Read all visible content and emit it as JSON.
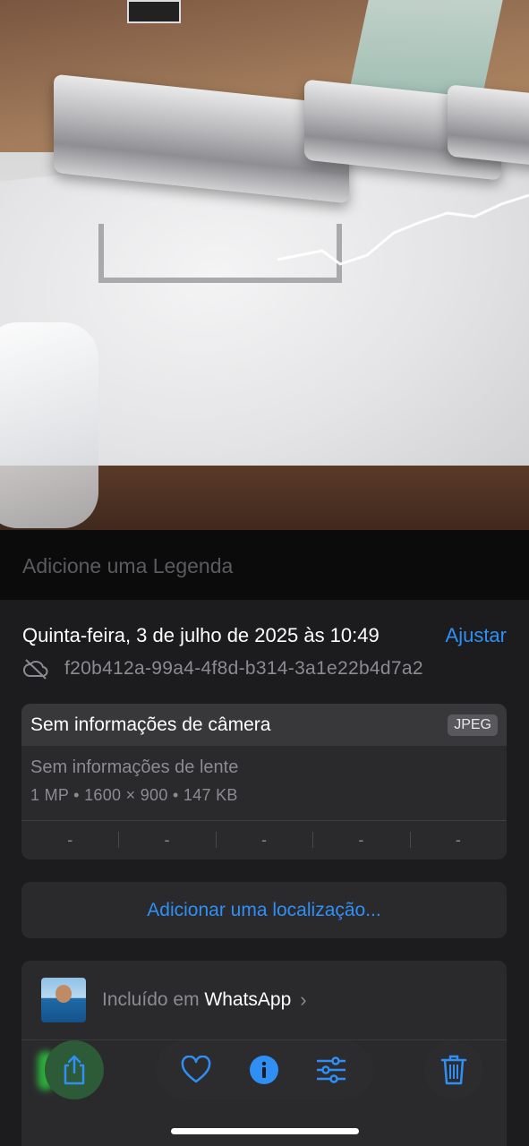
{
  "caption": {
    "placeholder": "Adicione uma Legenda"
  },
  "info": {
    "date": "Quinta-feira, 3 de julho de 2025 às 10:49",
    "adjust_label": "Ajustar",
    "file_id": "f20b412a-99a4-4f8d-b314-3a1e22b4d7a2",
    "cloud_status_icon": "icloud-off-icon"
  },
  "camera": {
    "title": "Sem informações de câmera",
    "format_badge": "JPEG",
    "lens": "Sem informações de lente",
    "specs": "1 MP  •  1600 × 900  •  147 KB",
    "exif": [
      "-",
      "-",
      "-",
      "-",
      "-"
    ]
  },
  "location": {
    "add_label": "Adicionar uma localização..."
  },
  "album": {
    "prefix": "Incluído em",
    "name": "WhatsApp"
  },
  "toolbar": {
    "share_icon": "share-icon",
    "favorite_icon": "heart-icon",
    "info_icon": "info-icon",
    "adjust_icon": "sliders-icon",
    "delete_icon": "trash-icon"
  },
  "colors": {
    "accent": "#2f8ff5",
    "background": "#1c1c1e",
    "card": "#2a2a2d"
  }
}
